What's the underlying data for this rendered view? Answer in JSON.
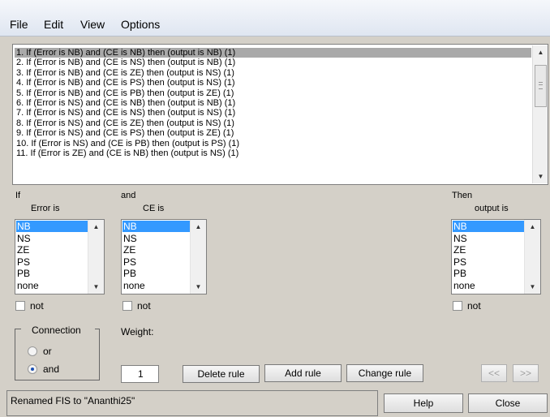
{
  "menu": [
    "File",
    "Edit",
    "View",
    "Options"
  ],
  "rules": [
    "1. If (Error is NB) and (CE is NB) then (output is NB) (1)",
    "2. If (Error is NB) and (CE is NS) then (output is NB) (1)",
    "3. If (Error is NB) and (CE is ZE) then (output is NS) (1)",
    "4. If (Error is NB) and (CE is PS) then (output is NS) (1)",
    "5. If (Error is NB) and (CE is PB) then (output is ZE) (1)",
    "6. If (Error is NS) and (CE is NB) then (output is NB) (1)",
    "7. If (Error is NS) and (CE is NS) then (output is NS) (1)",
    "8. If (Error is NS) and (CE is ZE) then (output is NS) (1)",
    "9. If (Error is NS) and (CE is PS) then (output is ZE) (1)",
    "10. If (Error is NS) and (CE is PB) then (output is PS) (1)",
    "11. If (Error is ZE) and (CE is NB) then (output is NS) (1)"
  ],
  "selected_rule_index": 0,
  "if_label": "If",
  "and_label": "and",
  "then_label": "Then",
  "error_label": "Error is",
  "ce_label": "CE is",
  "output_label": "output is",
  "mf_options": [
    "NB",
    "NS",
    "ZE",
    "PS",
    "PB",
    "none"
  ],
  "error_selected": "NB",
  "ce_selected": "NB",
  "output_selected": "NB",
  "not_label": "not",
  "connection": {
    "title": "Connection",
    "or_label": "or",
    "and_label": "and",
    "selected": "and"
  },
  "weight": {
    "label": "Weight:",
    "value": "1"
  },
  "buttons": {
    "delete_rule": "Delete rule",
    "add_rule": "Add rule",
    "change_rule": "Change rule",
    "prev": "<<",
    "next": ">>",
    "help": "Help",
    "close": "Close"
  },
  "status": "Renamed FIS to \"Ananthi25\"",
  "colors": {
    "selection_blue": "#3399ff",
    "selected_rule_gray": "#a9a9a9",
    "panel_bg": "#d4d0c8"
  }
}
